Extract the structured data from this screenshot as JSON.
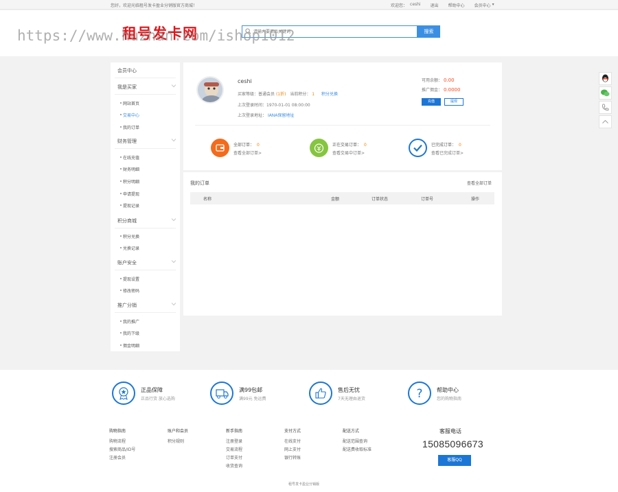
{
  "topbar": {
    "welcome": "您好，欢迎光临租号发卡盈业分销版官方商城！",
    "welcome_label": "欢迎您：",
    "username": "ceshi",
    "logout": "退出",
    "help": "帮助中心",
    "member": "会员中心",
    "member_arrow": "▾"
  },
  "header": {
    "logo": "租号发卡网",
    "watermark": "https://www.huzhan.com/ishop1012",
    "search_placeholder": "请输入要商品关键词",
    "search_button": "搜索"
  },
  "sidebar": {
    "title": "会员中心",
    "groups": [
      {
        "label": "我是买家",
        "items": [
          "网站首页",
          "交易中心",
          "我的订单"
        ]
      },
      {
        "label": "财务管理",
        "items": [
          "在线充值",
          "财务明细",
          "积分明细",
          "申请提现",
          "提现记录"
        ]
      },
      {
        "label": "积分商城",
        "items": [
          "积分兑换",
          "兑换记录"
        ]
      },
      {
        "label": "账户安全",
        "items": [
          "提现设置",
          "修改密码"
        ]
      },
      {
        "label": "推广分销",
        "items": [
          "我的推广",
          "我的下级",
          "佣金明细"
        ]
      }
    ]
  },
  "profile": {
    "username": "ceshi",
    "level_label": "买家等级：普通会员",
    "level_value": "(1折)",
    "points_label": "当前积分：",
    "points_value": "1",
    "points_link": "积分兑换",
    "last_login_time": "上次登录时间：1970-01-01 08:00:00",
    "last_login_addr_label": "上次登录地址：",
    "last_login_addr": "IANA保留地址",
    "balance_label": "可用余额：",
    "balance_value": "0.00",
    "commission_label": "推广佣金：",
    "commission_value": "0.0000",
    "recharge": "充值",
    "withdraw": "提现"
  },
  "stats": [
    {
      "label": "全部订单：",
      "value": "0",
      "link": "查看全部订单>",
      "color": "#f36b1c"
    },
    {
      "label": "正在交易订单：",
      "value": "0",
      "link": "查看交易中订单>",
      "color": "#86c540"
    },
    {
      "label": "已完成订单：",
      "value": "0",
      "link": "查看已完成订单>",
      "color": "#1b76d6"
    }
  ],
  "orders": {
    "title": "我的订单",
    "view_all": "查看全部订单",
    "columns": [
      "名称",
      "金额",
      "订单状态",
      "订单号",
      "操作"
    ]
  },
  "footer": {
    "services": [
      {
        "title": "正品保障",
        "sub": "正品行货 放心选购"
      },
      {
        "title": "满99包邮",
        "sub": "满99元 免运费"
      },
      {
        "title": "售后无忧",
        "sub": "7天无理由退货"
      },
      {
        "title": "帮助中心",
        "sub": "您的购物指南"
      }
    ],
    "columns": [
      {
        "title": "购物指南",
        "links": [
          "购物流程",
          "搜索商品/ID号",
          "注册会员"
        ]
      },
      {
        "title": "账户和会员",
        "links": [
          "积分规则"
        ]
      },
      {
        "title": "新手指南",
        "links": [
          "注册登录",
          "交易流程",
          "订单支付",
          "收货查询"
        ]
      },
      {
        "title": "支付方式",
        "links": [
          "在线支付",
          "网上支付",
          "银行转账"
        ]
      },
      {
        "title": "配送方式",
        "links": [
          "配送范围查询",
          "配送费收取标准"
        ]
      }
    ],
    "hotline_label": "客服电话",
    "hotline": "15085096673",
    "qq_button": "客服QQ",
    "copyright": "租号发卡盈业分销版"
  },
  "colors": {
    "accent": "#1b76d6",
    "search": "#3b8fe3",
    "logo": "#e0161b",
    "orange": "#f08200"
  }
}
